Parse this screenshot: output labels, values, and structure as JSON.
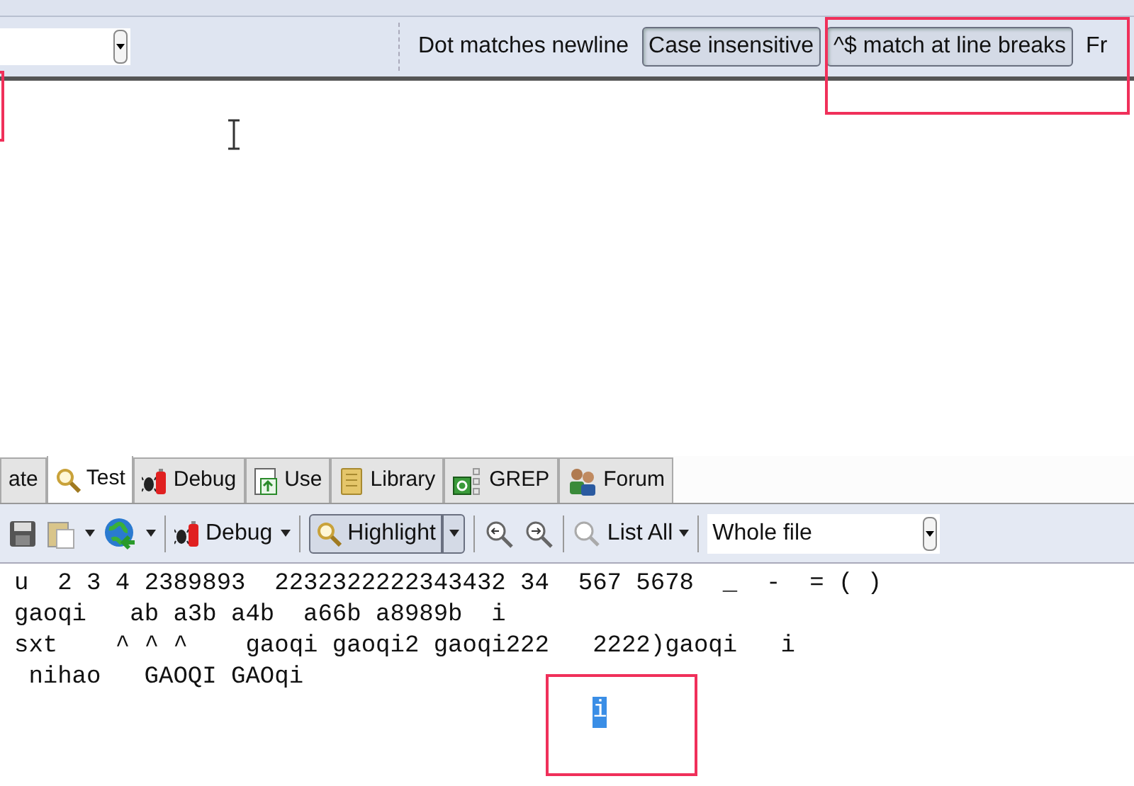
{
  "options_bar": {
    "toggles": [
      {
        "label": "Dot matches newline",
        "on": false
      },
      {
        "label": "Case insensitive",
        "on": true
      },
      {
        "label": "^$ match at line breaks",
        "on": true
      },
      {
        "label": "Fr",
        "on": false
      }
    ]
  },
  "tabs": [
    {
      "label": "ate",
      "selected": false
    },
    {
      "label": "Test",
      "selected": true
    },
    {
      "label": "Debug",
      "selected": false
    },
    {
      "label": "Use",
      "selected": false
    },
    {
      "label": "Library",
      "selected": false
    },
    {
      "label": "GREP",
      "selected": false
    },
    {
      "label": "Forum",
      "selected": false
    }
  ],
  "test_toolbar": {
    "debug_button": "Debug",
    "highlight": {
      "label": "Highlight",
      "on": true
    },
    "list_all": "List All",
    "scope": "Whole file"
  },
  "test_lines": [
    {
      "text": "u  2 3 4 2389893  2232322222343432 34  567 5678  _  -  = ( )",
      "selected": false
    },
    {
      "text": "gaoqi   ab a3b a4b  a66b a8989b  i",
      "selected": false
    },
    {
      "text": "sxt    ^ ^ ^    gaoqi gaoqi2 gaoqi222   2222)gaoqi   i",
      "selected": false
    },
    {
      "text": " nihao   GAOQI GAOqi",
      "selected": false
    },
    {
      "text": "                                        i",
      "selected": true
    }
  ]
}
